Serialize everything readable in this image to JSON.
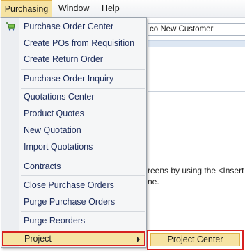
{
  "menubar": {
    "items": [
      {
        "label": "Purchasing"
      },
      {
        "label": "Window"
      },
      {
        "label": "Help"
      }
    ]
  },
  "background": {
    "field_value": "co New Customer",
    "text_line1": "reens by using the <Insert",
    "text_line2": "ne."
  },
  "purchasing_menu": {
    "items": [
      {
        "label": "Purchase Order Center",
        "icon": "shopping-cart-icon"
      },
      {
        "label": "Create POs from Requisition"
      },
      {
        "label": "Create Return Order"
      },
      {
        "label": "Purchase Order Inquiry"
      },
      {
        "label": "Quotations Center"
      },
      {
        "label": "Product Quotes"
      },
      {
        "label": "New Quotation"
      },
      {
        "label": "Import Quotations"
      },
      {
        "label": "Contracts"
      },
      {
        "label": "Close Purchase Orders"
      },
      {
        "label": "Purge Purchase Orders"
      },
      {
        "label": "Purge Reorders"
      },
      {
        "label": "Project",
        "has_submenu": true
      }
    ]
  },
  "project_submenu": {
    "items": [
      {
        "label": "Project Center"
      }
    ]
  },
  "colors": {
    "highlight": "#f6e3a3",
    "annotation_border": "#d62020",
    "menu_text": "#1a2a5a"
  }
}
